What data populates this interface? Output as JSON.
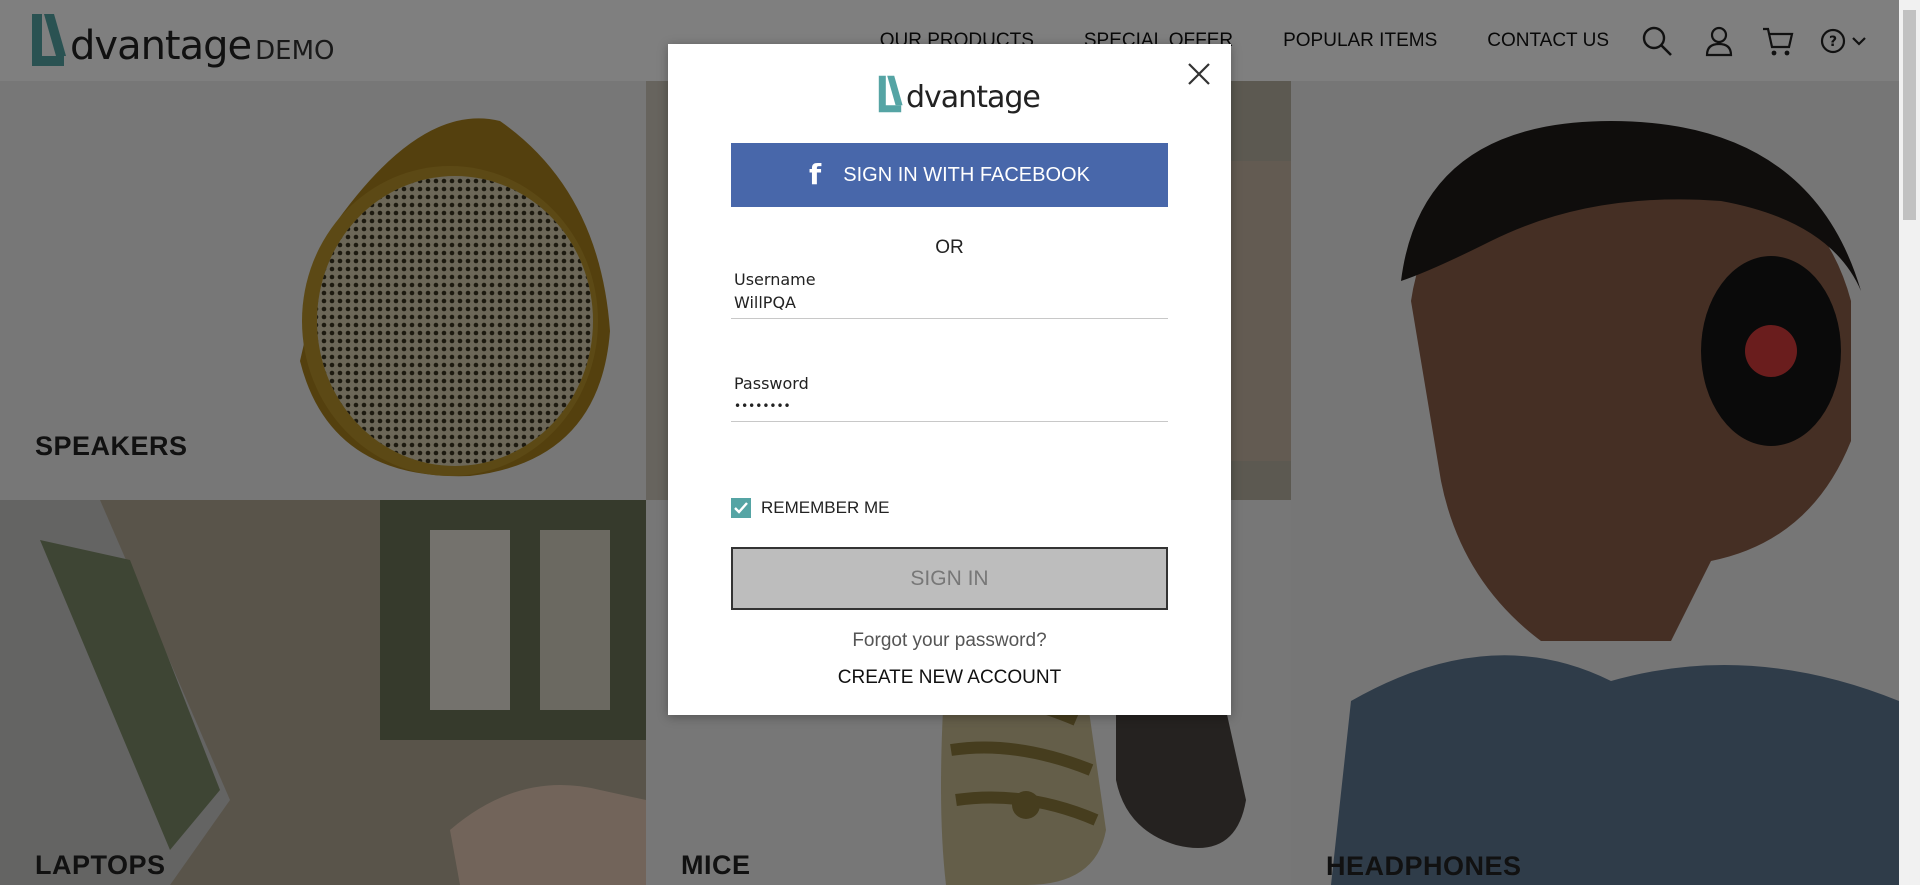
{
  "header": {
    "logo_text": "dvantage",
    "logo_suffix": "DEMO",
    "nav": [
      "OUR PRODUCTS",
      "SPECIAL OFFER",
      "POPULAR ITEMS",
      "CONTACT US"
    ]
  },
  "tiles": {
    "speakers": "SPEAKERS",
    "laptops": "LAPTOPS",
    "mice": "MICE",
    "headphones": "HEADPHONES"
  },
  "modal": {
    "logo_text": "dvantage",
    "facebook_label": "SIGN IN WITH FACEBOOK",
    "or_text": "OR",
    "username": {
      "label": "Username",
      "value": "WillPQA"
    },
    "password": {
      "label": "Password",
      "value": "••••••••"
    },
    "remember_label": "REMEMBER ME",
    "remember_checked": true,
    "signin_label": "SIGN IN",
    "forgot_label": "Forgot your password?",
    "create_label": "CREATE NEW ACCOUNT"
  },
  "colors": {
    "brand_teal": "#55a4a4",
    "facebook_blue": "#4867aa",
    "signin_disabled": "#bdbdbd"
  },
  "icons": [
    "search-icon",
    "user-icon",
    "cart-icon",
    "help-icon",
    "chevron-down-icon",
    "close-icon",
    "facebook-icon",
    "checkmark-icon"
  ]
}
